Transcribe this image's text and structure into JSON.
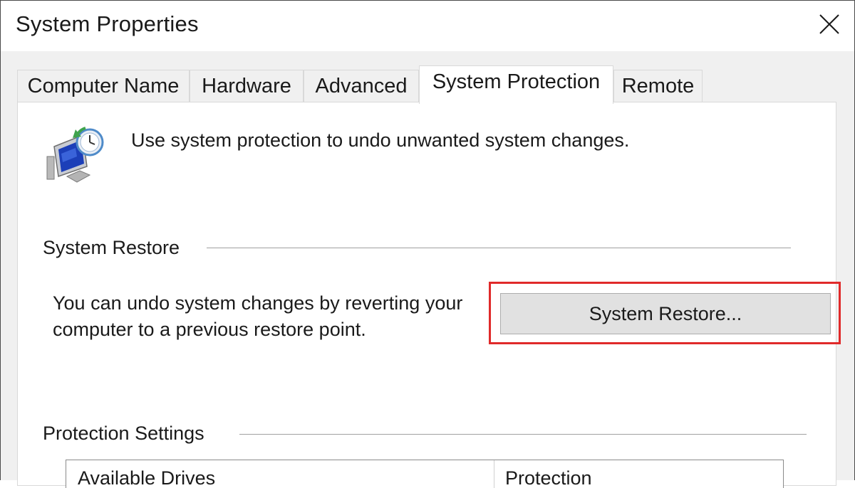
{
  "window": {
    "title": "System Properties",
    "close_icon": "close-icon"
  },
  "tabs": [
    {
      "label": "Computer Name",
      "active": false
    },
    {
      "label": "Hardware",
      "active": false
    },
    {
      "label": "Advanced",
      "active": false
    },
    {
      "label": "System Protection",
      "active": true
    },
    {
      "label": "Remote",
      "active": false
    }
  ],
  "header": {
    "icon": "system-protection-icon",
    "text": "Use system protection to undo unwanted system changes."
  },
  "system_restore": {
    "group_label": "System Restore",
    "description": "You can undo system changes by reverting your computer to a previous restore point.",
    "button_label": "System Restore...",
    "highlight_color": "#e02a2a"
  },
  "protection_settings": {
    "group_label": "Protection Settings",
    "columns": [
      "Available Drives",
      "Protection"
    ]
  }
}
